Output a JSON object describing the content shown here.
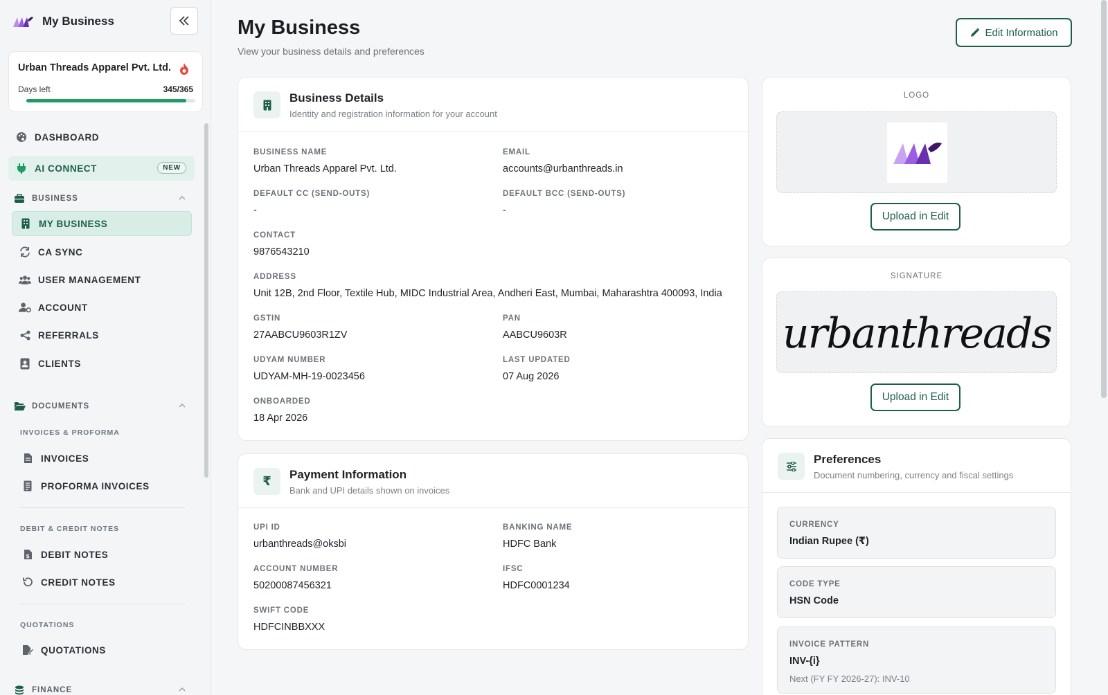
{
  "sidebar": {
    "brand": "My Business",
    "company": {
      "name": "Urban Threads Apparel Pvt. Ltd.",
      "days_label": "Days left",
      "days_value": "345/365",
      "progress": 0.945
    },
    "nav": {
      "dashboard": "DASHBOARD",
      "ai_connect": "AI CONNECT",
      "ai_badge": "NEW"
    },
    "business_section": {
      "title": "BUSINESS",
      "items": {
        "my_business": "MY BUSINESS",
        "ca_sync": "CA SYNC",
        "user_management": "USER MANAGEMENT",
        "account": "ACCOUNT",
        "referrals": "REFERRALS",
        "clients": "CLIENTS"
      }
    },
    "documents_section": {
      "title": "DOCUMENTS",
      "invoices_group": "INVOICES & PROFORMA",
      "invoices": "INVOICES",
      "proforma": "PROFORMA INVOICES",
      "notes_group": "DEBIT & CREDIT NOTES",
      "debit_notes": "DEBIT NOTES",
      "credit_notes": "CREDIT NOTES",
      "quotations_group": "QUOTATIONS",
      "quotations": "QUOTATIONS"
    },
    "finance_section": {
      "title": "FINANCE"
    }
  },
  "header": {
    "title": "My Business",
    "subtitle": "View your business details and preferences",
    "edit_label": "Edit Information"
  },
  "business_details": {
    "title": "Business Details",
    "subtitle": "Identity and registration information for your account",
    "fields": {
      "business_name": {
        "label": "BUSINESS NAME",
        "value": "Urban Threads Apparel Pvt. Ltd."
      },
      "email": {
        "label": "EMAIL",
        "value": "accounts@urbanthreads.in"
      },
      "default_cc": {
        "label": "DEFAULT CC (SEND-OUTS)",
        "value": "-"
      },
      "default_bcc": {
        "label": "DEFAULT BCC (SEND-OUTS)",
        "value": "-"
      },
      "contact": {
        "label": "CONTACT",
        "value": "9876543210"
      },
      "address": {
        "label": "ADDRESS",
        "value": "Unit 12B, 2nd Floor, Textile Hub, MIDC Industrial Area, Andheri East, Mumbai, Maharashtra 400093, India"
      },
      "gstin": {
        "label": "GSTIN",
        "value": "27AABCU9603R1ZV"
      },
      "pan": {
        "label": "PAN",
        "value": "AABCU9603R"
      },
      "udyam": {
        "label": "UDYAM NUMBER",
        "value": "UDYAM-MH-19-0023456"
      },
      "last_updated": {
        "label": "LAST UPDATED",
        "value": "07 Aug 2026"
      },
      "onboarded": {
        "label": "ONBOARDED",
        "value": "18 Apr 2026"
      }
    }
  },
  "payment_info": {
    "title": "Payment Information",
    "subtitle": "Bank and UPI details shown on invoices",
    "fields": {
      "upi": {
        "label": "UPI ID",
        "value": "urbanthreads@oksbi"
      },
      "banking_name": {
        "label": "BANKING NAME",
        "value": "HDFC Bank"
      },
      "account_number": {
        "label": "ACCOUNT NUMBER",
        "value": "50200087456321"
      },
      "ifsc": {
        "label": "IFSC",
        "value": "HDFC0001234"
      },
      "swift": {
        "label": "SWIFT CODE",
        "value": "HDFCINBBXXX"
      }
    }
  },
  "logo_card": {
    "label": "LOGO",
    "upload_label": "Upload in Edit"
  },
  "signature_card": {
    "label": "SIGNATURE",
    "upload_label": "Upload in Edit",
    "signature_text": "urbanthreads"
  },
  "preferences": {
    "title": "Preferences",
    "subtitle": "Document numbering, currency and fiscal settings",
    "currency": {
      "label": "CURRENCY",
      "value": "Indian Rupee (₹)"
    },
    "code_type": {
      "label": "CODE TYPE",
      "value": "HSN Code"
    },
    "invoice_pattern": {
      "label": "INVOICE PATTERN",
      "value": "INV-{i}",
      "note": "Next (FY FY 2026-27): INV-10"
    }
  },
  "colors": {
    "accent": "#1d5e4b",
    "accent_bg": "#d7ede6",
    "progress": "#1f9c62",
    "brand_purple": "#9b5de5",
    "fire": "#e24b3b"
  },
  "icons": {
    "collapse": "double-chevron-left-icon",
    "dashboard": "palette-icon",
    "ai_connect": "plug-icon",
    "business": "briefcase-icon",
    "documents": "folder-open-icon",
    "finance": "coins-icon",
    "edit": "pencil-icon"
  }
}
